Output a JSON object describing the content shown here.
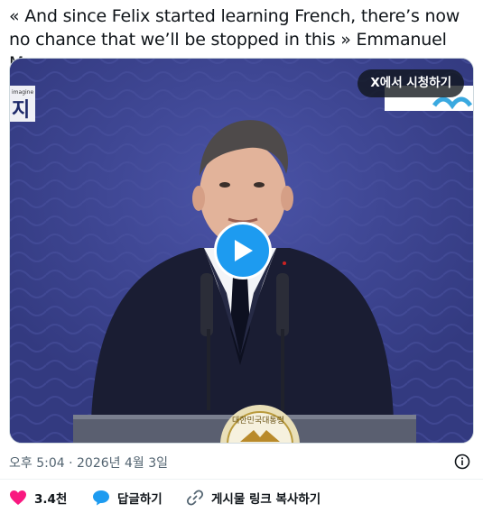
{
  "tweet": {
    "text": "« And since Felix started learning French, there’s now no chance that we’ll be stopped in this »  Emmanuel Macron"
  },
  "video": {
    "watch_on_x_label": "X에서 시청하기",
    "play_icon": "play-icon",
    "overlay_logo_text": "지",
    "overlay_logo_small": "imagine",
    "seal_text": "대한민국대통령"
  },
  "meta": {
    "timestamp": "오후 5:04 · 2026년 4월 3일"
  },
  "actions": {
    "like_count": "3.4천",
    "reply_label": "답글하기",
    "copy_link_label": "게시물 링크 복사하기"
  },
  "colors": {
    "accent": "#1d9bf0",
    "like": "#f91880",
    "stage_blue": "#3c438e"
  }
}
